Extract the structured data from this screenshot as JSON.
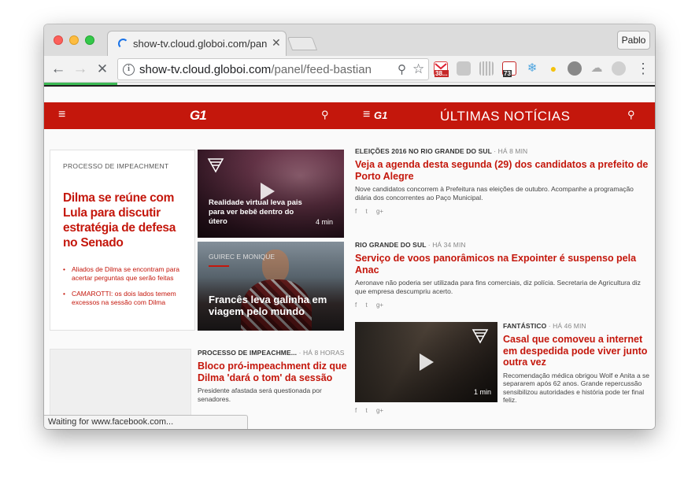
{
  "browser": {
    "tab_title": "show-tv.cloud.globoi.com/panel/",
    "tab_close": "✕",
    "profile": "Pablo",
    "url_host": "show-tv.cloud.globoi.com",
    "url_path": "/panel/feed-bastian",
    "ext_badge_gmail": "38...",
    "ext_badge_cal": "73",
    "status": "Waiting for www.facebook.com..."
  },
  "left": {
    "logo": "G1",
    "feature": {
      "section": "PROCESSO DE IMPEACHMENT",
      "title": "Dilma se reúne com Lula para discutir estratégia de defesa no Senado",
      "items": [
        "Aliados de Dilma se encontram para acertar perguntas que serão feitas",
        "CAMAROTTI: os dois lados temem excessos na sessão com Dilma"
      ]
    },
    "media1": {
      "caption": "Realidade virtual leva pais para ver bebê dentro do útero",
      "duration": "4 min"
    },
    "media2": {
      "kicker": "GUIREC E MONIQUE",
      "caption": "Francês leva galinha em viagem pelo mundo"
    },
    "story": {
      "kicker": "PROCESSO DE IMPEACHME...",
      "time": "· HÁ 8 HORAS",
      "headline": "Bloco pró-impeachment diz que Dilma 'dará o tom' da sessão",
      "summary": "Presidente afastada será questionada por senadores."
    }
  },
  "right": {
    "logo": "G1",
    "title": "ÚLTIMAS NOTÍCIAS",
    "stories": [
      {
        "kicker": "ELEIÇÕES 2016 NO RIO GRANDE DO SUL",
        "time": "· HÁ 8 MIN",
        "headline": "Veja a agenda desta segunda (29) dos candidatos a prefeito de Porto Alegre",
        "summary": "Nove candidatos concorrem à Prefeitura nas eleições de outubro. Acompanhe a programação diária dos concorrentes ao Paço Municipal."
      },
      {
        "kicker": "RIO GRANDE DO SUL",
        "time": "· HÁ 34 MIN",
        "headline": "Serviço de voos panorâmicos na Expointer é suspenso pela Anac",
        "summary": "Aeronave não poderia ser utilizada para fins comerciais, diz polícia. Secretaria de Agricultura diz que empresa descumpriu acerto."
      },
      {
        "kicker": "FANTÁSTICO",
        "time": "· HÁ 46 MIN",
        "headline": "Casal que comoveu a internet em despedida pode viver junto outra vez",
        "summary": "Recomendação médica obrigou Wolf e Anita a se separarem após 62 anos. Grande repercussão sensibilizou autoridades e história pode ter final feliz.",
        "duration": "1 min"
      }
    ],
    "share": {
      "facebook": "f",
      "twitter": "t",
      "gplus": "g+"
    }
  },
  "colors": {
    "g1_red": "#c4170c",
    "progress": "#3cba54"
  },
  "page_load_progress": 0.12
}
